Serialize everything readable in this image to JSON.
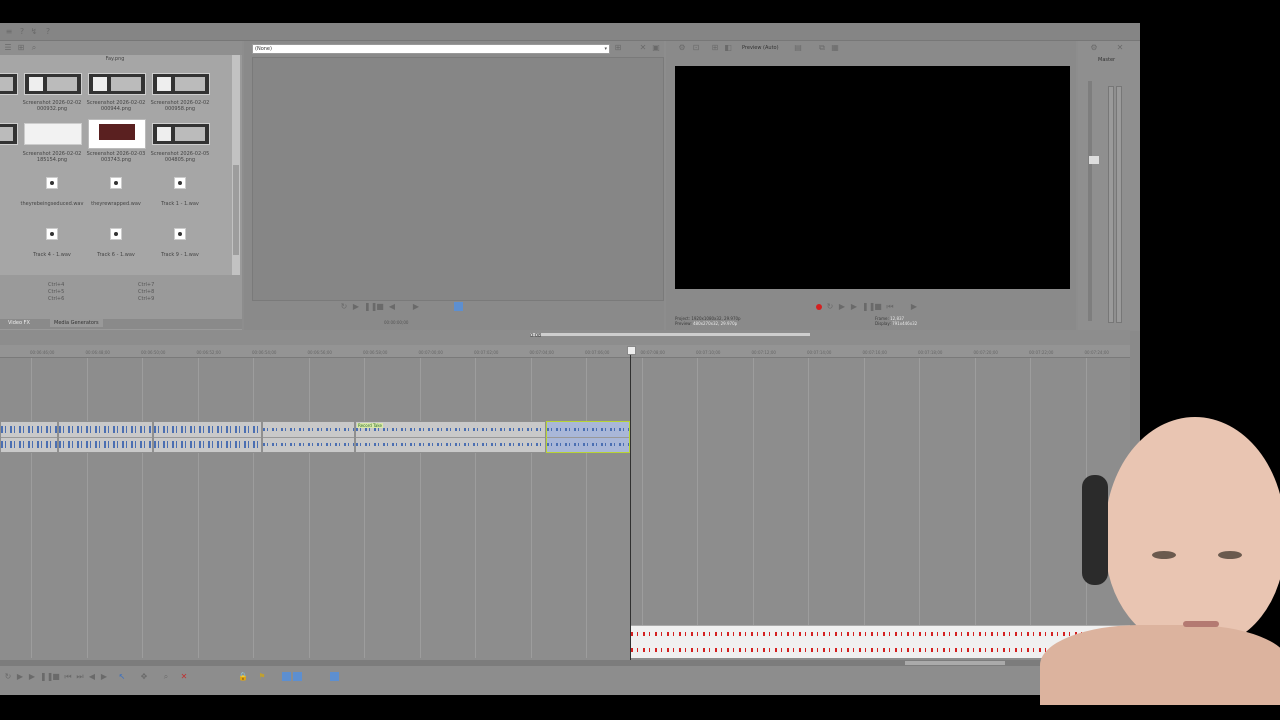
{
  "media_panel": {
    "thumbnails": [
      {
        "label": "Fay.png"
      },
      {
        "label": "Screenshot 2026-02-02 000932.png"
      },
      {
        "label": "Screenshot 2026-02-02 000944.png"
      },
      {
        "label": "Screenshot 2026-02-02 000958.png"
      },
      {
        "label": "Screenshot 2026-02-02 185154.png"
      },
      {
        "label": "Screenshot 2026-02-03 003743.png"
      },
      {
        "label": "Screenshot 2026-02-05 004805.png"
      }
    ],
    "audio_files": [
      {
        "label": "theyrebeingseduced.wav"
      },
      {
        "label": "theyrewrapped.wav"
      },
      {
        "label": "Track 1 - 1.wav"
      },
      {
        "label": "Track 4 - 1.wav"
      },
      {
        "label": "Track 6 - 1.wav"
      },
      {
        "label": "Track 9 - 1.wav"
      }
    ],
    "shortcuts": [
      "Ctrl+4",
      "Ctrl+5",
      "Ctrl+6",
      "Ctrl+7",
      "Ctrl+8",
      "Ctrl+9"
    ],
    "tabs": [
      "Video FX",
      "Media Generators"
    ]
  },
  "trimmer": {
    "source_value": "(None)",
    "timecode": "00:00:00;00"
  },
  "preview": {
    "quality": "Preview (Auto)",
    "project_label": "Project:",
    "project_value": "1920x1080x32, 29.970p",
    "preview_label": "Preview:",
    "preview_value": "480x270x32, 29.970p",
    "frame_label": "Frame:",
    "frame_value": "12,837",
    "display_label": "Display:",
    "display_value": "791x446x32"
  },
  "master": {
    "label": "Master"
  },
  "timeline": {
    "marker_time": "0:08",
    "clip_tag": "Record Take",
    "ruler_ticks": [
      "00:06:46;00",
      "00:06:48;00",
      "00:06:50;00",
      "00:06:52;00",
      "00:06:54;00",
      "00:06:56;00",
      "00:06:58;00",
      "00:07:00;00",
      "00:07:02;00",
      "00:07:04;00",
      "00:07:06;00",
      "00:07:08;00",
      "00:07:10;00",
      "00:07:12;00",
      "00:07:14;00",
      "00:07:16;00",
      "00:07:18;00",
      "00:07:20;00",
      "00:07:22;00",
      "00:07:24;00"
    ]
  },
  "colors": {
    "panel_bg": "#7b7b7b",
    "window_bg": "#8d8d8d",
    "preview_black": "#000000",
    "waveform_blue": "#4b6fb2",
    "selected_clip_border": "#b8d434",
    "record_red": "#d42020"
  }
}
